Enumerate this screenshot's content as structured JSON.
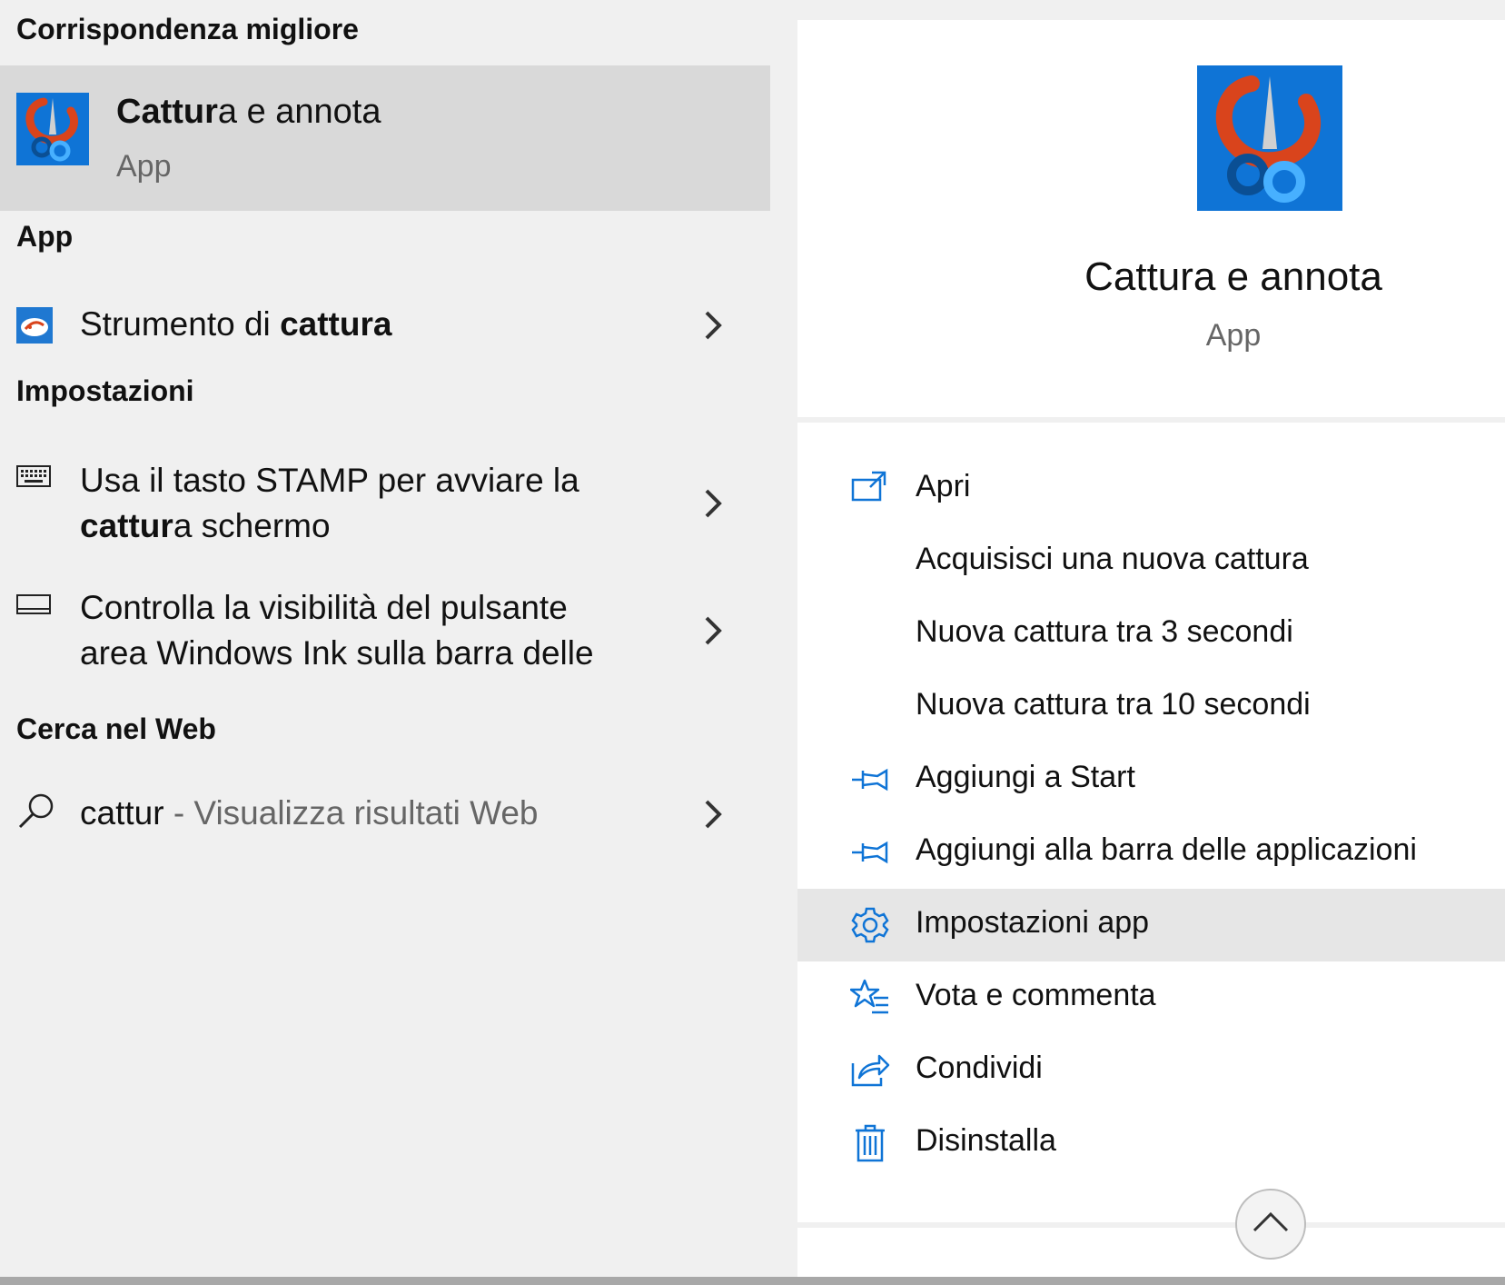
{
  "left": {
    "best_match_heading": "Corrispondenza migliore",
    "best_match": {
      "title_bold": "Cattur",
      "title_rest": "a e annota",
      "subtitle": "App",
      "icon": "snip-sketch-icon"
    },
    "app_heading": "App",
    "app_item": {
      "text_pre": "Strumento di ",
      "text_bold": "cattura",
      "icon": "snipping-tool-icon"
    },
    "settings_heading": "Impostazioni",
    "settings_items": [
      {
        "line1": "Usa il tasto STAMP per avviare la",
        "line2_bold": "cattur",
        "line2_rest": "a schermo",
        "icon": "keyboard-icon"
      },
      {
        "line1": "Controlla la visibilità del pulsante",
        "line2": "area Windows Ink sulla barra delle",
        "icon": "taskbar-icon"
      }
    ],
    "web_heading": "Cerca nel Web",
    "web_item": {
      "query": "cattur",
      "suffix": " - Visualizza risultati Web",
      "icon": "search-icon"
    }
  },
  "right": {
    "title": "Cattura e annota",
    "subtitle": "App",
    "actions": [
      {
        "label": "Apri",
        "icon": "open-icon"
      },
      {
        "label": "Acquisisci una nuova cattura",
        "icon": ""
      },
      {
        "label": "Nuova cattura tra 3 secondi",
        "icon": ""
      },
      {
        "label": "Nuova cattura tra 10 secondi",
        "icon": ""
      },
      {
        "label": "Aggiungi a Start",
        "icon": "pin-icon"
      },
      {
        "label": "Aggiungi alla barra delle applicazioni",
        "icon": "pin-icon"
      },
      {
        "label": "Impostazioni app",
        "icon": "gear-icon"
      },
      {
        "label": "Vota e commenta",
        "icon": "star-list-icon"
      },
      {
        "label": "Condividi",
        "icon": "share-icon"
      },
      {
        "label": "Disinstalla",
        "icon": "trash-icon"
      }
    ],
    "highlighted_action": "Impostazioni app"
  },
  "colors": {
    "accent": "#0f74d6",
    "panel_bg": "#f0f0f0",
    "selected_bg": "#d9d9d9",
    "hover_bg": "#e6e6e6",
    "icon_red": "#d9441c"
  }
}
